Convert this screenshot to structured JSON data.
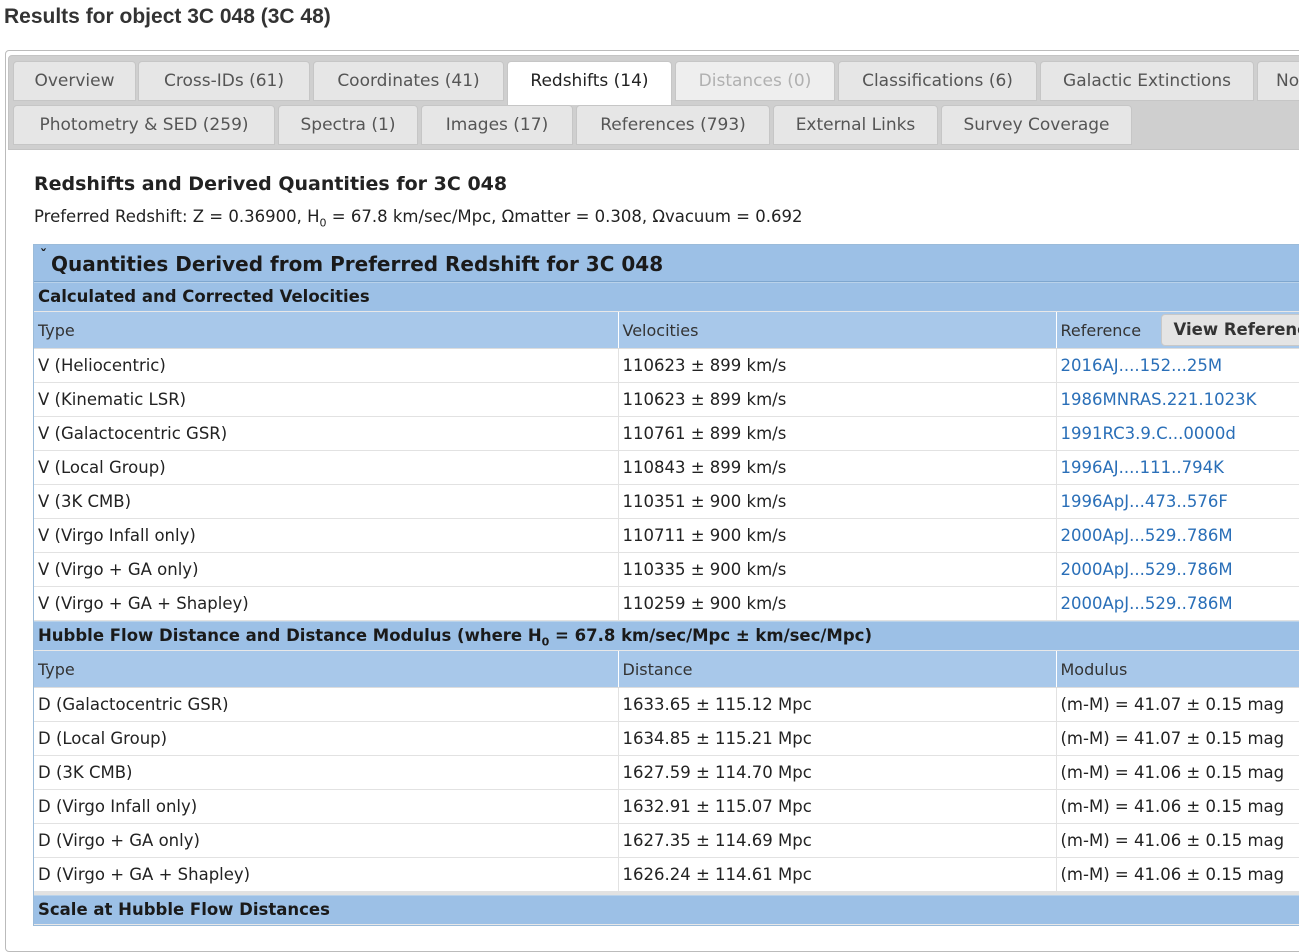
{
  "page": {
    "title": "Results for object 3C 048 (3C 48)"
  },
  "tabs": {
    "overview": "Overview",
    "cross_ids": "Cross-IDs (61)",
    "coordinates": "Coordinates (41)",
    "redshifts": "Redshifts (14)",
    "distances": "Distances (0)",
    "classifications": "Classifications (6)",
    "galactic_extinctions": "Galactic Extinctions",
    "notes": "No",
    "photometry": "Photometry & SED (259)",
    "spectra": "Spectra (1)",
    "images": "Images (17)",
    "references": "References (793)",
    "external_links": "External Links",
    "survey_coverage": "Survey Coverage"
  },
  "main": {
    "heading": "Redshifts and Derived Quantities for 3C 048",
    "preferred": {
      "prefix": "Preferred Redshift: Z = 0.36900, H",
      "sub": "0",
      "suffix": " = 67.8 km/sec/Mpc, Ωmatter = 0.308, Ωvacuum = 0.692"
    }
  },
  "panel": {
    "caret": "ˇ",
    "title": "Quantities Derived from Preferred Redshift for 3C 048",
    "velocities": {
      "title": "Calculated and Corrected Velocities",
      "headers": {
        "type": "Type",
        "value": "Velocities",
        "ref": "Reference"
      },
      "view_refs_button": "View References",
      "rows": [
        {
          "type": "V (Heliocentric)",
          "value": "110623 ± 899 km/s",
          "ref": "2016AJ....152...25M"
        },
        {
          "type": "V (Kinematic LSR)",
          "value": "110623 ± 899 km/s",
          "ref": "1986MNRAS.221.1023K"
        },
        {
          "type": "V (Galactocentric GSR)",
          "value": "110761 ± 899 km/s",
          "ref": "1991RC3.9.C...0000d"
        },
        {
          "type": "V (Local Group)",
          "value": "110843 ± 899 km/s",
          "ref": "1996AJ....111..794K"
        },
        {
          "type": "V (3K CMB)",
          "value": "110351 ± 900 km/s",
          "ref": "1996ApJ...473..576F"
        },
        {
          "type": "V (Virgo Infall only)",
          "value": "110711 ± 900 km/s",
          "ref": "2000ApJ...529..786M"
        },
        {
          "type": "V (Virgo + GA only)",
          "value": "110335 ± 900 km/s",
          "ref": "2000ApJ...529..786M"
        },
        {
          "type": "V (Virgo + GA + Shapley)",
          "value": "110259 ± 900 km/s",
          "ref": "2000ApJ...529..786M"
        }
      ]
    },
    "distances": {
      "title_prefix": "Hubble Flow Distance and Distance Modulus (where H",
      "title_sub": "0",
      "title_suffix": " = 67.8 km/sec/Mpc ± km/sec/Mpc)",
      "headers": {
        "type": "Type",
        "value": "Distance",
        "modulus": "Modulus"
      },
      "rows": [
        {
          "type": "D (Galactocentric GSR)",
          "value": "1633.65 ± 115.12 Mpc",
          "modulus": "(m-M) = 41.07 ± 0.15 mag"
        },
        {
          "type": "D (Local Group)",
          "value": "1634.85 ± 115.21 Mpc",
          "modulus": "(m-M) = 41.07 ± 0.15 mag"
        },
        {
          "type": "D (3K CMB)",
          "value": "1627.59 ± 114.70 Mpc",
          "modulus": "(m-M) = 41.06 ± 0.15 mag"
        },
        {
          "type": "D (Virgo Infall only)",
          "value": "1632.91 ± 115.07 Mpc",
          "modulus": "(m-M) = 41.06 ± 0.15 mag"
        },
        {
          "type": "D (Virgo + GA only)",
          "value": "1627.35 ± 114.69 Mpc",
          "modulus": "(m-M) = 41.06 ± 0.15 mag"
        },
        {
          "type": "D (Virgo + GA + Shapley)",
          "value": "1626.24 ± 114.61 Mpc",
          "modulus": "(m-M) = 41.06 ± 0.15 mag"
        }
      ]
    },
    "scale": {
      "title": "Scale at Hubble Flow Distances"
    }
  }
}
